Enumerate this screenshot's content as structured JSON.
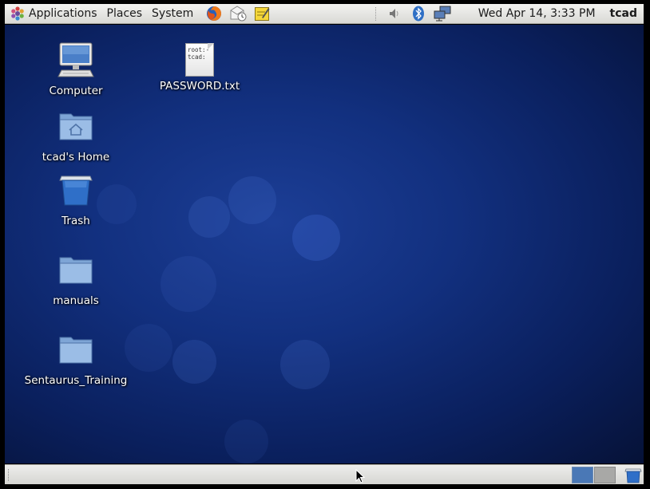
{
  "top_panel": {
    "menus": {
      "applications": "Applications",
      "places": "Places",
      "system": "System"
    },
    "launchers": [
      "firefox-icon",
      "mail-clock-icon",
      "notes-icon"
    ],
    "tray_icons": [
      "volume-icon",
      "bluetooth-icon",
      "network-icon"
    ],
    "clock": "Wed Apr 14,  3:33 PM",
    "user": "tcad"
  },
  "desktop": {
    "icons": [
      {
        "label": "Computer",
        "icon": "computer-icon"
      },
      {
        "label": "PASSWORD.txt",
        "icon": "text-file-icon",
        "preview_lines": [
          "root:-",
          "tcad:"
        ]
      },
      {
        "label": "tcad's Home",
        "icon": "home-folder-icon"
      },
      {
        "label": "Trash",
        "icon": "trash-icon"
      },
      {
        "label": "manuals",
        "icon": "folder-icon"
      },
      {
        "label": "Sentaurus_Training",
        "icon": "folder-icon"
      }
    ]
  },
  "bottom_panel": {
    "workspaces": [
      "workspace-1",
      "workspace-2"
    ],
    "active_workspace": 1
  },
  "colors": {
    "desktop_bg": "#12307f",
    "panel_bg": "#e6e6e3",
    "workspace_active": "#4a78b6"
  }
}
